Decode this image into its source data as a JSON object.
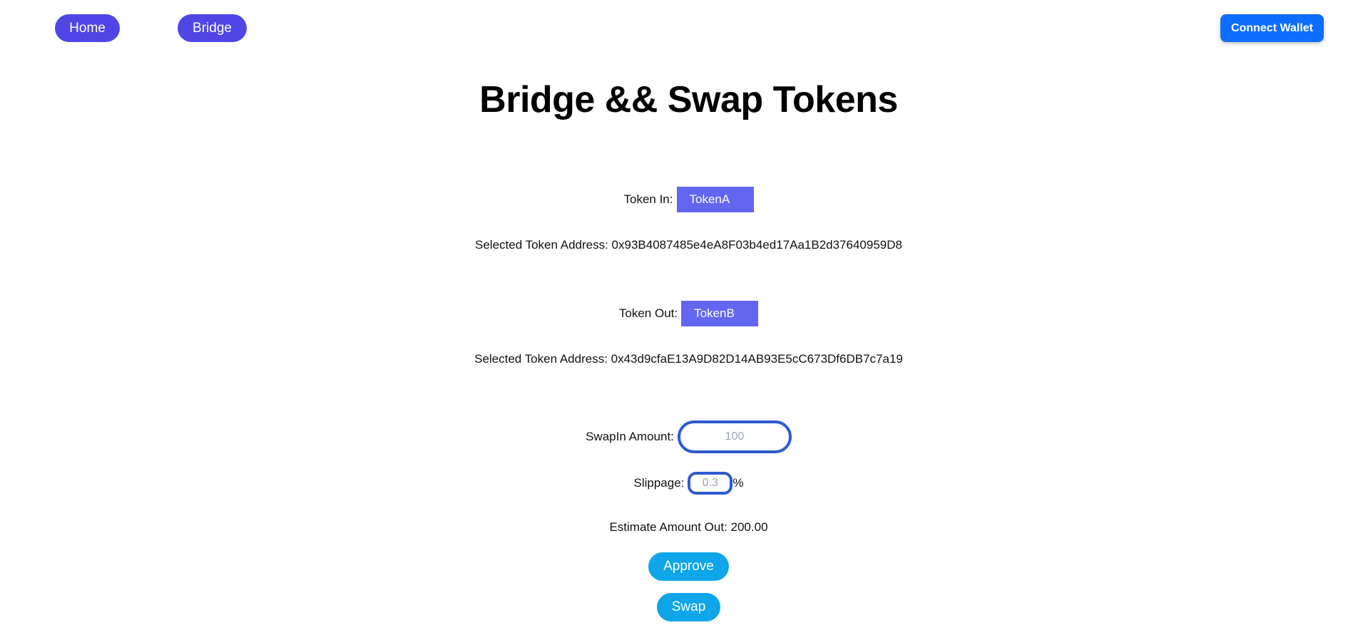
{
  "nav": {
    "home_label": "Home",
    "bridge_label": "Bridge"
  },
  "wallet": {
    "connect_label": "Connect Wallet"
  },
  "page": {
    "title": "Bridge && Swap Tokens"
  },
  "token_in": {
    "label": "Token In:",
    "selected": "TokenA",
    "address_text": "Selected Token Address: 0x93B4087485e4eA8F03b4ed17Aa1B2d37640959D8"
  },
  "token_out": {
    "label": "Token Out:",
    "selected": "TokenB",
    "address_text": "Selected Token Address: 0x43d9cfaE13A9D82D14AB93E5cC673Df6DB7c7a19"
  },
  "swap_in": {
    "label": "SwapIn Amount:",
    "placeholder": "100",
    "value": ""
  },
  "slippage": {
    "label": "Slippage:",
    "placeholder": "0.3",
    "unit": "%"
  },
  "estimate": {
    "text": "Estimate Amount Out: 200.00"
  },
  "actions": {
    "approve_label": "Approve",
    "swap_label": "Swap"
  },
  "colors": {
    "nav_pill": "#4f46e5",
    "connect_wallet": "#0d6efd",
    "token_select": "#6366f1",
    "input_border": "#2f5bd0",
    "action_button": "#0ea5e9"
  }
}
